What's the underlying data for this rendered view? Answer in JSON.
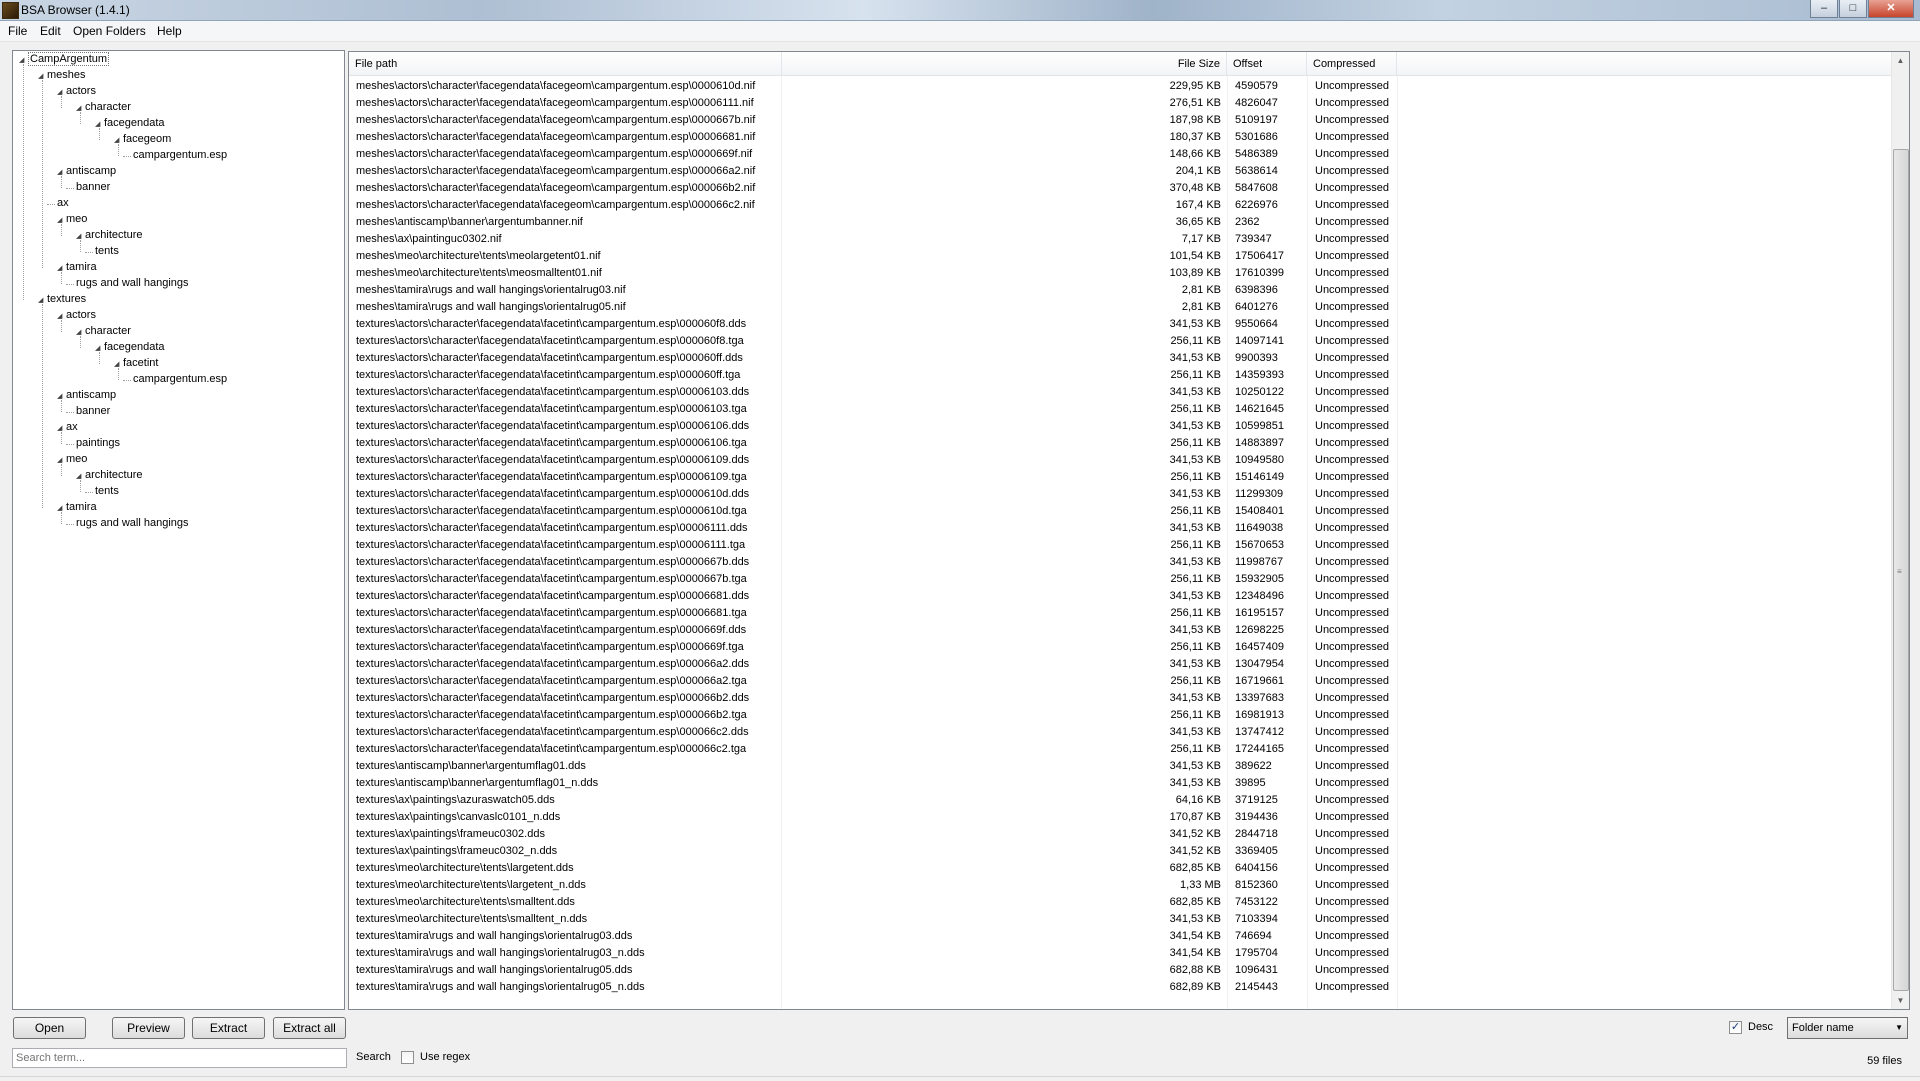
{
  "window": {
    "title": "BSA Browser (1.4.1)",
    "min_label": "–",
    "max_label": "□",
    "close_label": "✕"
  },
  "menu": [
    "File",
    "Edit",
    "Open Folders",
    "Help"
  ],
  "tree": [
    {
      "label": "CampArgentum",
      "level": 0,
      "expanded": true,
      "selected": true
    },
    {
      "label": "meshes",
      "level": 1,
      "expanded": true
    },
    {
      "label": "actors",
      "level": 2,
      "expanded": true
    },
    {
      "label": "character",
      "level": 3,
      "expanded": true
    },
    {
      "label": "facegendata",
      "level": 4,
      "expanded": true
    },
    {
      "label": "facegeom",
      "level": 5,
      "expanded": true
    },
    {
      "label": "campargentum.esp",
      "level": 6
    },
    {
      "label": "antiscamp",
      "level": 2,
      "expanded": true
    },
    {
      "label": "banner",
      "level": 3
    },
    {
      "label": "ax",
      "level": 2
    },
    {
      "label": "meo",
      "level": 2,
      "expanded": true
    },
    {
      "label": "architecture",
      "level": 3,
      "expanded": true
    },
    {
      "label": "tents",
      "level": 4
    },
    {
      "label": "tamira",
      "level": 2,
      "expanded": true
    },
    {
      "label": "rugs and wall hangings",
      "level": 3
    },
    {
      "label": "textures",
      "level": 1,
      "expanded": true
    },
    {
      "label": "actors",
      "level": 2,
      "expanded": true
    },
    {
      "label": "character",
      "level": 3,
      "expanded": true
    },
    {
      "label": "facegendata",
      "level": 4,
      "expanded": true
    },
    {
      "label": "facetint",
      "level": 5,
      "expanded": true
    },
    {
      "label": "campargentum.esp",
      "level": 6
    },
    {
      "label": "antiscamp",
      "level": 2,
      "expanded": true
    },
    {
      "label": "banner",
      "level": 3
    },
    {
      "label": "ax",
      "level": 2,
      "expanded": true
    },
    {
      "label": "paintings",
      "level": 3
    },
    {
      "label": "meo",
      "level": 2,
      "expanded": true
    },
    {
      "label": "architecture",
      "level": 3,
      "expanded": true
    },
    {
      "label": "tents",
      "level": 4
    },
    {
      "label": "tamira",
      "level": 2,
      "expanded": true
    },
    {
      "label": "rugs and wall hangings",
      "level": 3
    }
  ],
  "columns": {
    "path": "File path",
    "size": "File Size",
    "offset": "Offset",
    "compressed": "Compressed"
  },
  "files": [
    [
      "meshes\\actors\\character\\facegendata\\facegeom\\campargentum.esp\\0000610d.nif",
      "229,95 KB",
      "4590579",
      "Uncompressed"
    ],
    [
      "meshes\\actors\\character\\facegendata\\facegeom\\campargentum.esp\\00006111.nif",
      "276,51 KB",
      "4826047",
      "Uncompressed"
    ],
    [
      "meshes\\actors\\character\\facegendata\\facegeom\\campargentum.esp\\0000667b.nif",
      "187,98 KB",
      "5109197",
      "Uncompressed"
    ],
    [
      "meshes\\actors\\character\\facegendata\\facegeom\\campargentum.esp\\00006681.nif",
      "180,37 KB",
      "5301686",
      "Uncompressed"
    ],
    [
      "meshes\\actors\\character\\facegendata\\facegeom\\campargentum.esp\\0000669f.nif",
      "148,66 KB",
      "5486389",
      "Uncompressed"
    ],
    [
      "meshes\\actors\\character\\facegendata\\facegeom\\campargentum.esp\\000066a2.nif",
      "204,1 KB",
      "5638614",
      "Uncompressed"
    ],
    [
      "meshes\\actors\\character\\facegendata\\facegeom\\campargentum.esp\\000066b2.nif",
      "370,48 KB",
      "5847608",
      "Uncompressed"
    ],
    [
      "meshes\\actors\\character\\facegendata\\facegeom\\campargentum.esp\\000066c2.nif",
      "167,4 KB",
      "6226976",
      "Uncompressed"
    ],
    [
      "meshes\\antiscamp\\banner\\argentumbanner.nif",
      "36,65 KB",
      "2362",
      "Uncompressed"
    ],
    [
      "meshes\\ax\\paintinguc0302.nif",
      "7,17 KB",
      "739347",
      "Uncompressed"
    ],
    [
      "meshes\\meo\\architecture\\tents\\meolargetent01.nif",
      "101,54 KB",
      "17506417",
      "Uncompressed"
    ],
    [
      "meshes\\meo\\architecture\\tents\\meosmalltent01.nif",
      "103,89 KB",
      "17610399",
      "Uncompressed"
    ],
    [
      "meshes\\tamira\\rugs and wall hangings\\orientalrug03.nif",
      "2,81 KB",
      "6398396",
      "Uncompressed"
    ],
    [
      "meshes\\tamira\\rugs and wall hangings\\orientalrug05.nif",
      "2,81 KB",
      "6401276",
      "Uncompressed"
    ],
    [
      "textures\\actors\\character\\facegendata\\facetint\\campargentum.esp\\000060f8.dds",
      "341,53 KB",
      "9550664",
      "Uncompressed"
    ],
    [
      "textures\\actors\\character\\facegendata\\facetint\\campargentum.esp\\000060f8.tga",
      "256,11 KB",
      "14097141",
      "Uncompressed"
    ],
    [
      "textures\\actors\\character\\facegendata\\facetint\\campargentum.esp\\000060ff.dds",
      "341,53 KB",
      "9900393",
      "Uncompressed"
    ],
    [
      "textures\\actors\\character\\facegendata\\facetint\\campargentum.esp\\000060ff.tga",
      "256,11 KB",
      "14359393",
      "Uncompressed"
    ],
    [
      "textures\\actors\\character\\facegendata\\facetint\\campargentum.esp\\00006103.dds",
      "341,53 KB",
      "10250122",
      "Uncompressed"
    ],
    [
      "textures\\actors\\character\\facegendata\\facetint\\campargentum.esp\\00006103.tga",
      "256,11 KB",
      "14621645",
      "Uncompressed"
    ],
    [
      "textures\\actors\\character\\facegendata\\facetint\\campargentum.esp\\00006106.dds",
      "341,53 KB",
      "10599851",
      "Uncompressed"
    ],
    [
      "textures\\actors\\character\\facegendata\\facetint\\campargentum.esp\\00006106.tga",
      "256,11 KB",
      "14883897",
      "Uncompressed"
    ],
    [
      "textures\\actors\\character\\facegendata\\facetint\\campargentum.esp\\00006109.dds",
      "341,53 KB",
      "10949580",
      "Uncompressed"
    ],
    [
      "textures\\actors\\character\\facegendata\\facetint\\campargentum.esp\\00006109.tga",
      "256,11 KB",
      "15146149",
      "Uncompressed"
    ],
    [
      "textures\\actors\\character\\facegendata\\facetint\\campargentum.esp\\0000610d.dds",
      "341,53 KB",
      "11299309",
      "Uncompressed"
    ],
    [
      "textures\\actors\\character\\facegendata\\facetint\\campargentum.esp\\0000610d.tga",
      "256,11 KB",
      "15408401",
      "Uncompressed"
    ],
    [
      "textures\\actors\\character\\facegendata\\facetint\\campargentum.esp\\00006111.dds",
      "341,53 KB",
      "11649038",
      "Uncompressed"
    ],
    [
      "textures\\actors\\character\\facegendata\\facetint\\campargentum.esp\\00006111.tga",
      "256,11 KB",
      "15670653",
      "Uncompressed"
    ],
    [
      "textures\\actors\\character\\facegendata\\facetint\\campargentum.esp\\0000667b.dds",
      "341,53 KB",
      "11998767",
      "Uncompressed"
    ],
    [
      "textures\\actors\\character\\facegendata\\facetint\\campargentum.esp\\0000667b.tga",
      "256,11 KB",
      "15932905",
      "Uncompressed"
    ],
    [
      "textures\\actors\\character\\facegendata\\facetint\\campargentum.esp\\00006681.dds",
      "341,53 KB",
      "12348496",
      "Uncompressed"
    ],
    [
      "textures\\actors\\character\\facegendata\\facetint\\campargentum.esp\\00006681.tga",
      "256,11 KB",
      "16195157",
      "Uncompressed"
    ],
    [
      "textures\\actors\\character\\facegendata\\facetint\\campargentum.esp\\0000669f.dds",
      "341,53 KB",
      "12698225",
      "Uncompressed"
    ],
    [
      "textures\\actors\\character\\facegendata\\facetint\\campargentum.esp\\0000669f.tga",
      "256,11 KB",
      "16457409",
      "Uncompressed"
    ],
    [
      "textures\\actors\\character\\facegendata\\facetint\\campargentum.esp\\000066a2.dds",
      "341,53 KB",
      "13047954",
      "Uncompressed"
    ],
    [
      "textures\\actors\\character\\facegendata\\facetint\\campargentum.esp\\000066a2.tga",
      "256,11 KB",
      "16719661",
      "Uncompressed"
    ],
    [
      "textures\\actors\\character\\facegendata\\facetint\\campargentum.esp\\000066b2.dds",
      "341,53 KB",
      "13397683",
      "Uncompressed"
    ],
    [
      "textures\\actors\\character\\facegendata\\facetint\\campargentum.esp\\000066b2.tga",
      "256,11 KB",
      "16981913",
      "Uncompressed"
    ],
    [
      "textures\\actors\\character\\facegendata\\facetint\\campargentum.esp\\000066c2.dds",
      "341,53 KB",
      "13747412",
      "Uncompressed"
    ],
    [
      "textures\\actors\\character\\facegendata\\facetint\\campargentum.esp\\000066c2.tga",
      "256,11 KB",
      "17244165",
      "Uncompressed"
    ],
    [
      "textures\\antiscamp\\banner\\argentumflag01.dds",
      "341,53 KB",
      "389622",
      "Uncompressed"
    ],
    [
      "textures\\antiscamp\\banner\\argentumflag01_n.dds",
      "341,53 KB",
      "39895",
      "Uncompressed"
    ],
    [
      "textures\\ax\\paintings\\azuraswatch05.dds",
      "64,16 KB",
      "3719125",
      "Uncompressed"
    ],
    [
      "textures\\ax\\paintings\\canvaslc0101_n.dds",
      "170,87 KB",
      "3194436",
      "Uncompressed"
    ],
    [
      "textures\\ax\\paintings\\frameuc0302.dds",
      "341,52 KB",
      "2844718",
      "Uncompressed"
    ],
    [
      "textures\\ax\\paintings\\frameuc0302_n.dds",
      "341,52 KB",
      "3369405",
      "Uncompressed"
    ],
    [
      "textures\\meo\\architecture\\tents\\largetent.dds",
      "682,85 KB",
      "6404156",
      "Uncompressed"
    ],
    [
      "textures\\meo\\architecture\\tents\\largetent_n.dds",
      "1,33 MB",
      "8152360",
      "Uncompressed"
    ],
    [
      "textures\\meo\\architecture\\tents\\smalltent.dds",
      "682,85 KB",
      "7453122",
      "Uncompressed"
    ],
    [
      "textures\\meo\\architecture\\tents\\smalltent_n.dds",
      "341,53 KB",
      "7103394",
      "Uncompressed"
    ],
    [
      "textures\\tamira\\rugs and wall hangings\\orientalrug03.dds",
      "341,54 KB",
      "746694",
      "Uncompressed"
    ],
    [
      "textures\\tamira\\rugs and wall hangings\\orientalrug03_n.dds",
      "341,54 KB",
      "1795704",
      "Uncompressed"
    ],
    [
      "textures\\tamira\\rugs and wall hangings\\orientalrug05.dds",
      "682,88 KB",
      "1096431",
      "Uncompressed"
    ],
    [
      "textures\\tamira\\rugs and wall hangings\\orientalrug05_n.dds",
      "682,89 KB",
      "2145443",
      "Uncompressed"
    ]
  ],
  "buttons": {
    "open": "Open",
    "preview": "Preview",
    "extract": "Extract",
    "extract_all": "Extract all"
  },
  "search": {
    "placeholder": "Search term...",
    "value": "",
    "label": "Search",
    "regex_label": "Use regex",
    "regex_checked": false
  },
  "sort": {
    "desc_label": "Desc",
    "desc_checked": true,
    "selected": "Folder name"
  },
  "status": {
    "file_count": "59 files"
  }
}
